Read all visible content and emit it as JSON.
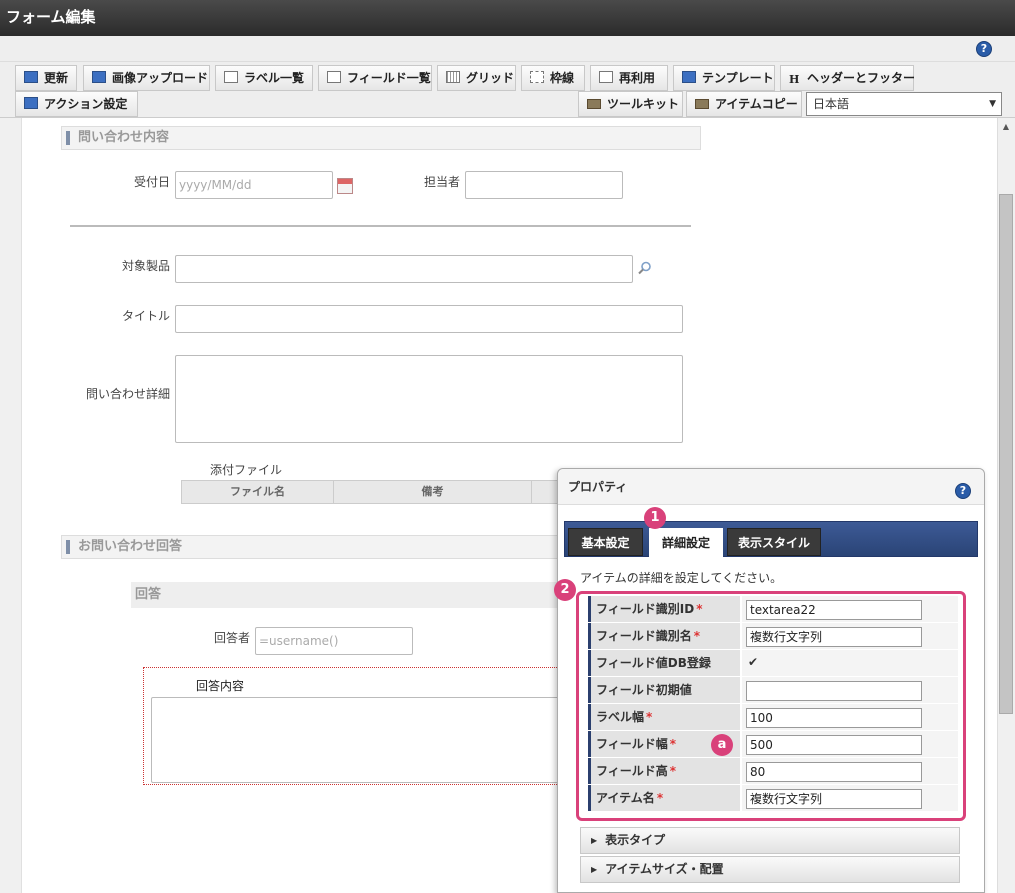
{
  "window": {
    "title": "フォーム編集"
  },
  "help": {
    "icon": "?"
  },
  "toolbar": {
    "row1": [
      {
        "label": "更新",
        "icon": "refresh-icon"
      },
      {
        "label": "画像アップロード",
        "icon": "image-upload-icon"
      },
      {
        "label": "ラベル一覧",
        "icon": "label-list-icon"
      },
      {
        "label": "フィールド一覧",
        "icon": "field-list-icon"
      },
      {
        "label": "グリッド",
        "icon": "grid-icon"
      },
      {
        "label": "枠線",
        "icon": "border-icon"
      },
      {
        "label": "再利用",
        "icon": "reuse-icon"
      },
      {
        "label": "テンプレート",
        "icon": "template-icon"
      },
      {
        "label": "ヘッダーとフッター",
        "icon": "header-footer-icon"
      }
    ],
    "action": {
      "label": "アクション設定",
      "icon": "action-icon"
    },
    "toolkit": {
      "label": "ツールキット",
      "icon": "toolkit-icon"
    },
    "item_copy": {
      "label": "アイテムコピー",
      "icon": "item-copy-icon"
    },
    "language": "日本語"
  },
  "form": {
    "section1": "問い合わせ内容",
    "received_date": {
      "label": "受付日",
      "placeholder": "yyyy/MM/dd"
    },
    "assignee": {
      "label": "担当者"
    },
    "product": {
      "label": "対象製品"
    },
    "title": {
      "label": "タイトル"
    },
    "detail": {
      "label": "問い合わせ詳細"
    },
    "attachment": {
      "label": "添付ファイル",
      "columns": [
        "ファイル名",
        "備考"
      ]
    },
    "section2": "お問い合わせ回答",
    "answer_head": "回答",
    "answerer": {
      "label": "回答者",
      "value": "=username()"
    },
    "answer_content": {
      "label": "回答内容"
    }
  },
  "properties": {
    "title": "プロパティ",
    "tabs": [
      "基本設定",
      "詳細設定",
      "表示スタイル"
    ],
    "active_tab": "詳細設定",
    "description": "アイテムの詳細を設定してください。",
    "rows": [
      {
        "label": "フィールド識別ID",
        "required": "*",
        "value": "textarea22"
      },
      {
        "label": "フィールド識別名",
        "required": "*",
        "value": "複数行文字列"
      },
      {
        "label": "フィールド値DB登録",
        "required": "",
        "value": "",
        "checked": true
      },
      {
        "label": "フィールド初期値",
        "required": "",
        "value": ""
      },
      {
        "label": "ラベル幅",
        "required": "*",
        "value": "100"
      },
      {
        "label": "フィールド幅",
        "required": "*",
        "value": "500"
      },
      {
        "label": "フィールド高",
        "required": "*",
        "value": "80"
      },
      {
        "label": "アイテム名",
        "required": "*",
        "value": "複数行文字列"
      }
    ],
    "accordions": [
      "表示タイプ",
      "アイテムサイズ・配置"
    ]
  },
  "callouts": {
    "tab": "1",
    "table": "2",
    "field_width": "a"
  },
  "colors": {
    "callout": "#d9417a",
    "tab_strip": "#2a4476"
  }
}
